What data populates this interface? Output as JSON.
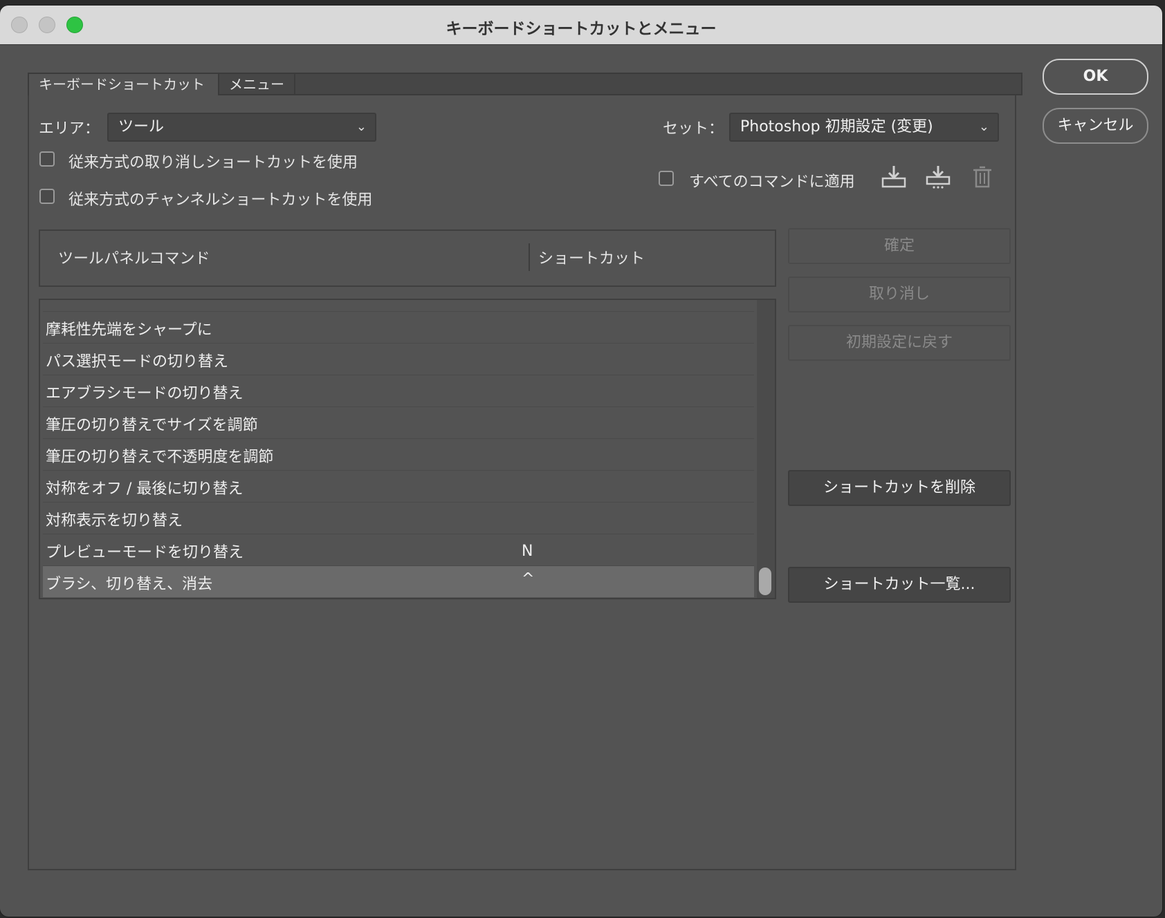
{
  "window": {
    "title": "キーボードショートカットとメニュー"
  },
  "buttons": {
    "ok": "OK",
    "cancel": "キャンセル",
    "confirm": "確定",
    "undo": "取り消し",
    "reset": "初期設定に戻す",
    "delete_shortcut": "ショートカットを削除",
    "summarize": "ショートカット一覧..."
  },
  "tabs": [
    {
      "label": "キーボードショートカット",
      "selected": true
    },
    {
      "label": "メニュー",
      "selected": false
    }
  ],
  "area": {
    "label": "エリア：",
    "value": "ツール"
  },
  "set": {
    "label": "セット：",
    "value": "Photoshop 初期設定 (変更)"
  },
  "options": {
    "legacy_undo": {
      "label": "従来方式の取り消しショートカットを使用",
      "checked": false
    },
    "legacy_channel": {
      "label": "従来方式のチャンネルショートカットを使用",
      "checked": false
    },
    "apply_all": {
      "label": "すべてのコマンドに適用",
      "checked": false
    }
  },
  "icons": {
    "save_set": "save-set-icon",
    "save_as_set": "save-set-as-icon",
    "delete_set": "trash-icon"
  },
  "table": {
    "columns": [
      "ツールパネルコマンド",
      "ショートカット"
    ],
    "rows": [
      {
        "command": "摩耗性先端をシャープに",
        "shortcut": ""
      },
      {
        "command": "パス選択モードの切り替え",
        "shortcut": ""
      },
      {
        "command": "エアブラシモードの切り替え",
        "shortcut": ""
      },
      {
        "command": "筆圧の切り替えでサイズを調節",
        "shortcut": ""
      },
      {
        "command": "筆圧の切り替えで不透明度を調節",
        "shortcut": ""
      },
      {
        "command": "対称をオフ / 最後に切り替え",
        "shortcut": ""
      },
      {
        "command": "対称表示を切り替え",
        "shortcut": ""
      },
      {
        "command": "プレビューモードを切り替え",
        "shortcut": "N"
      },
      {
        "command": "ブラシ、切り替え、消去",
        "shortcut": "^",
        "selected": true
      }
    ]
  },
  "colors": {
    "window_bg": "#535353",
    "titlebar_bg": "#d9d9d9",
    "maximize": "#2ec343",
    "selected_row": "#6a6a6a"
  }
}
